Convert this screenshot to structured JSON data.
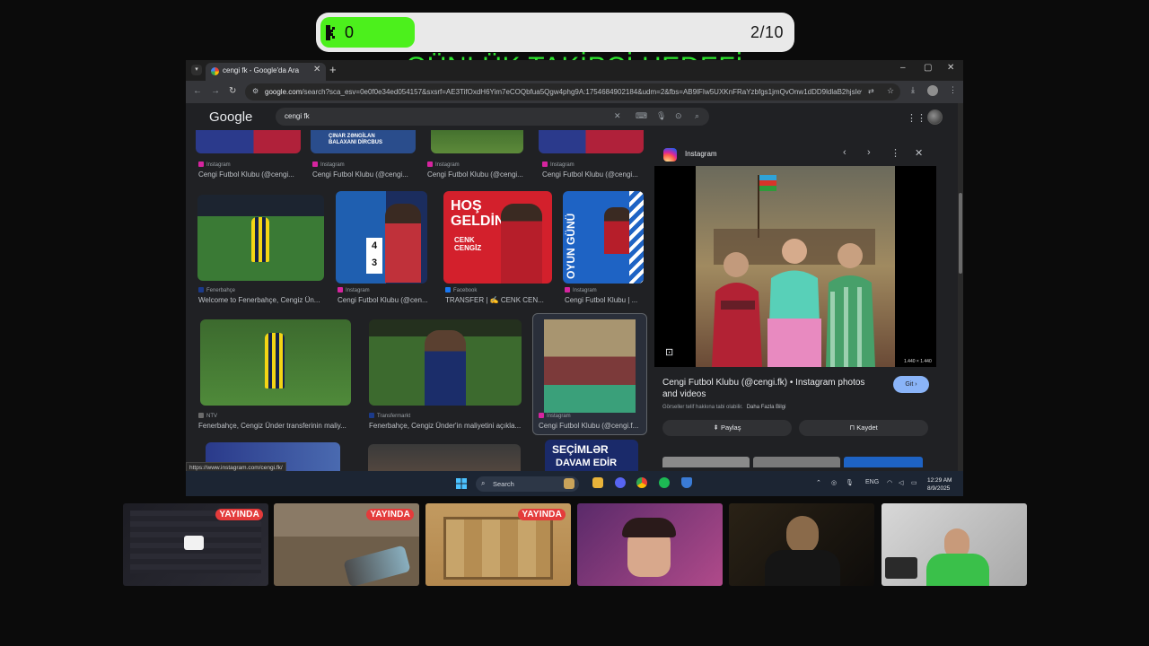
{
  "overlay": {
    "goal_count": "0",
    "goal_progress": "2/10",
    "goal_progress_ratio": 0.2,
    "goal_title": "GÜNLÜK TAKİPÇİ HEDEFİ",
    "fill_color": "#4cf01c",
    "title_color": "#2ee52e"
  },
  "browser": {
    "tab_title": "cengi fk - Google'da Ara",
    "tab_close": "✕",
    "new_tab": "+",
    "window_buttons": [
      "–",
      "▢",
      "✕"
    ],
    "url_host": "google.com",
    "url_path": "/search?sca_esv=0e0f0e34ed054157&sxsrf=AE3TifOxdH6Yim7eCOQbfua5Qgw4phg9A:1754684902184&udm=2&fbs=AB9lFIw5UXKnFRaYzbfgs1jmQvOnw1dDD9ldlaB2hjsIevE6...",
    "status_url": "https://www.instagram.com/cengi.fk/"
  },
  "google": {
    "logo": "Google",
    "query": "cengi fk",
    "results": [
      {
        "source": "Instagram",
        "caption": "Cengi Futbol Klubu (@cengi..."
      },
      {
        "source": "Instagram",
        "caption": "Cengi Futbol Klubu (@cengi..."
      },
      {
        "source": "Instagram",
        "caption": "Cengi Futbol Klubu (@cengi..."
      },
      {
        "source": "Instagram",
        "caption": "Cengi Futbol Klubu (@cengi..."
      },
      {
        "source": "Fenerbahçe",
        "caption": "Welcome to Fenerbahçe, Cengiz Ün..."
      },
      {
        "source": "Instagram",
        "caption": "Cengi Futbol Klubu (@cen..."
      },
      {
        "source": "Facebook",
        "caption": "TRANSFER | ✍ CENK CEN..."
      },
      {
        "source": "Instagram",
        "caption": "Cengi Futbol Klubu | ..."
      },
      {
        "source": "NTV",
        "caption": "Fenerbahçe, Cengiz Ünder transferinin maliy..."
      },
      {
        "source": "Transfermarkt",
        "caption": "Fenerbahçe, Cengiz Ünder'in maliyetini açıkla..."
      },
      {
        "source": "Instagram",
        "caption": "Cengi Futbol Klubu (@cengi.f..."
      }
    ],
    "thumb_texts": {
      "top_banner": "ÇINAR ZƏNGİLAN BALAXANI DİRCBUS",
      "hos_geldin": "HOŞ GELDİN",
      "cenk_cengiz": "CENK CENGİZ",
      "oyun_gunu": "OYUN GÜNÜ",
      "score_top": "4",
      "score_bottom": "3",
      "secimler": "SEÇİMLƏR",
      "davam": "DAVAM EDİR"
    }
  },
  "panel": {
    "source": "Instagram",
    "title": "Cengi Futbol Klubu (@cengi.fk) • Instagram photos and videos",
    "go_button": "Git",
    "note": "Görseller telif hakkına tabi olabilir.",
    "note_link": "Daha Fazla Bilgi",
    "share_button": "Paylaş",
    "save_button": "Kaydet",
    "dimensions": "1.440 × 1.440"
  },
  "taskbar": {
    "search_label": "Search",
    "lang": "ENG",
    "time": "12:29 AM",
    "date": "8/9/2025"
  },
  "webcams": {
    "live_label": "YAYINDA"
  }
}
